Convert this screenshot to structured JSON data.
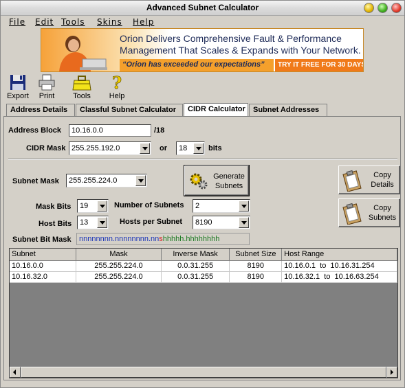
{
  "window": {
    "title": "Advanced Subnet Calculator"
  },
  "menu": [
    "File",
    "Edit",
    "Tools",
    "Skins",
    "Help"
  ],
  "banner": {
    "line1": "Orion Delivers Comprehensive Fault & Performance",
    "line2": "Management That Scales & Expands with Your Network.",
    "quote": "“Orion has exceeded our expectations”",
    "cta": "TRY IT FREE FOR 30 DAYS »"
  },
  "toolbar": {
    "export": "Export",
    "print": "Print",
    "tools": "Tools",
    "help": "Help"
  },
  "tabs": [
    "Address Details",
    "Classful Subnet Calculator",
    "CIDR Calculator",
    "Subnet Addresses"
  ],
  "cidr": {
    "address_block_label": "Address Block",
    "address_block_value": "10.16.0.0",
    "address_block_suffix": "/18",
    "cidr_mask_label": "CIDR Mask",
    "cidr_mask_value": "255.255.192.0",
    "or_label": "or",
    "bits_value": "18",
    "bits_label": "bits",
    "subnet_mask_label": "Subnet Mask",
    "subnet_mask_value": "255.255.224.0",
    "generate_label_1": "Generate",
    "generate_label_2": "Subnets",
    "copy_details_1": "Copy",
    "copy_details_2": "Details",
    "copy_subnets_1": "Copy",
    "copy_subnets_2": "Subnets",
    "mask_bits_label": "Mask Bits",
    "mask_bits_value": "19",
    "num_subnets_label": "Number of Subnets",
    "num_subnets_value": "2",
    "host_bits_label": "Host Bits",
    "host_bits_value": "13",
    "hosts_per_subnet_label": "Hosts per Subnet",
    "hosts_per_subnet_value": "8190",
    "subnet_bit_mask_label": "Subnet Bit Mask",
    "bitmask_n": "nnnnnnnn.nnnnnnnn.nn",
    "bitmask_s": "s",
    "bitmask_h": "hhhhh.hhhhhhhh"
  },
  "table": {
    "columns": [
      "Subnet",
      "Mask",
      "Inverse Mask",
      "Subnet Size",
      "Host Range"
    ],
    "rows": [
      [
        "10.16.0.0",
        "255.255.224.0",
        "0.0.31.255",
        "8190",
        "10.16.0.1  to  10.16.31.254"
      ],
      [
        "10.16.32.0",
        "255.255.224.0",
        "0.0.31.255",
        "8190",
        "10.16.32.1  to  10.16.63.254"
      ]
    ]
  }
}
